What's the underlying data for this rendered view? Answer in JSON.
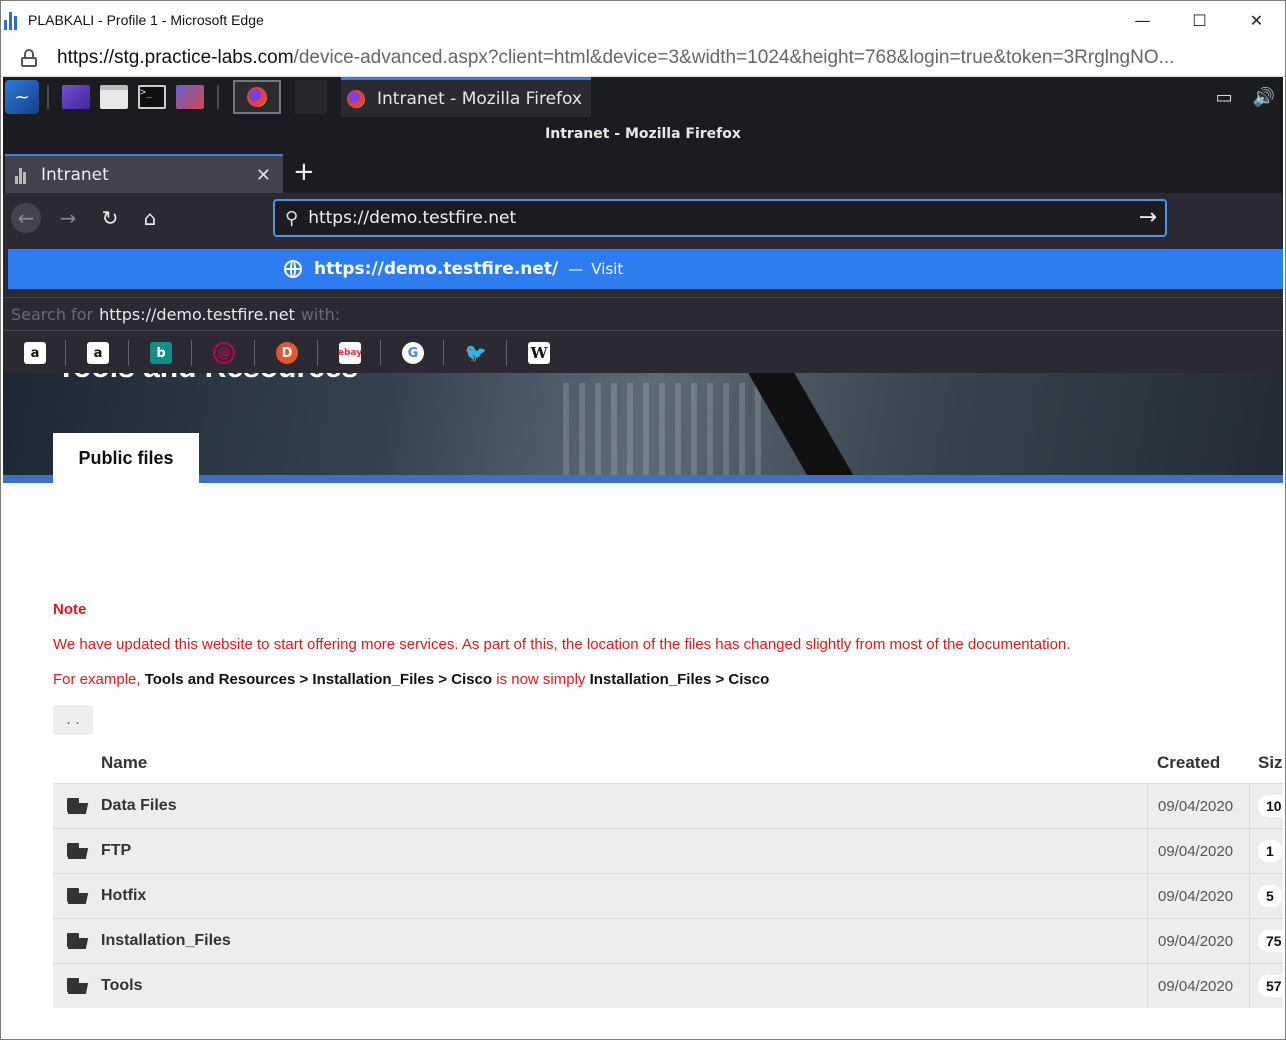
{
  "edge": {
    "title": "PLABKALI - Profile 1 - Microsoft Edge",
    "url_domain": "https://stg.practice-labs.com",
    "url_path": "/device-advanced.aspx?client=html&device=3&width=1024&height=768&login=true&token=3RrglngNO...",
    "minimize": "—",
    "maximize": "☐",
    "close": "✕"
  },
  "taskbar": {
    "task_label": "Intranet - Mozilla Firefox",
    "terminal_glyph": ">_"
  },
  "firefox": {
    "window_title": "Intranet - Mozilla Firefox",
    "tab_label": "Intranet",
    "tab_close": "✕",
    "new_tab": "+",
    "url_value": "https://demo.testfire.net",
    "suggestion_url": "https://demo.testfire.net/",
    "suggestion_dash": "—",
    "suggestion_action": "Visit",
    "search_for_prefix": "Search for",
    "search_term": "https://demo.testfire.net",
    "search_with_suffix": "with:",
    "engines": [
      {
        "name": "amazon",
        "glyph": "a"
      },
      {
        "name": "amazon-alt",
        "glyph": "a"
      },
      {
        "name": "bing",
        "glyph": "b"
      },
      {
        "name": "debian",
        "glyph": "@"
      },
      {
        "name": "duckduckgo",
        "glyph": "D"
      },
      {
        "name": "ebay",
        "glyph": "ebay"
      },
      {
        "name": "google",
        "glyph": "G"
      },
      {
        "name": "twitter",
        "glyph": "🐦"
      },
      {
        "name": "wikipedia",
        "glyph": "W"
      }
    ]
  },
  "page": {
    "hero_title": "Tools and Resources",
    "tab_label": "Public files",
    "note_title": "Note",
    "note_line1": "We have updated this website to start offering more services. As part of this, the location of the files has changed slightly from most of the documentation.",
    "note_ex_prefix": "For example,",
    "note_ex_old": "Tools and Resources > Installation_Files > Cisco",
    "note_ex_mid": "is now simply",
    "note_ex_new": "Installation_Files > Cisco",
    "up_dir": ". .",
    "columns": {
      "name": "Name",
      "created": "Created",
      "size": "Siz"
    },
    "rows": [
      {
        "name": "Data Files",
        "created": "09/04/2020",
        "size": "10"
      },
      {
        "name": "FTP",
        "created": "09/04/2020",
        "size": "1"
      },
      {
        "name": "Hotfix",
        "created": "09/04/2020",
        "size": "5"
      },
      {
        "name": "Installation_Files",
        "created": "09/04/2020",
        "size": "75"
      },
      {
        "name": "Tools",
        "created": "09/04/2020",
        "size": "57"
      }
    ]
  },
  "colors": {
    "accent_blue": "#2d7cf0",
    "note_red": "#d81b1b",
    "firefox_dark": "#1c1b22"
  }
}
